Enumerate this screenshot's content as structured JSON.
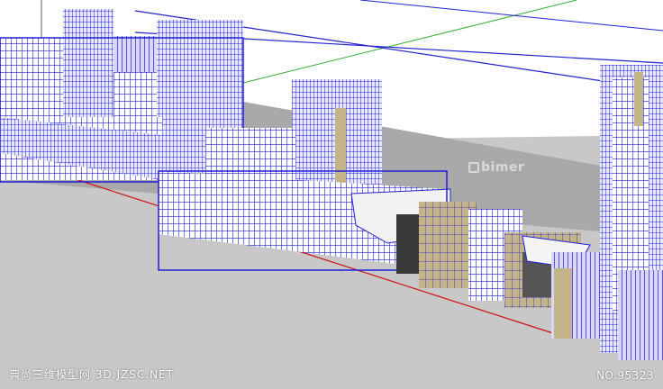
{
  "viewport": {
    "sky_color": "#ffffff",
    "ground_color": "#c8c8c8",
    "slab_color": "#a9a9a9",
    "wire_color": "#1f1fd8",
    "facade_color": "#c4b48a",
    "axis_red": "#d01010",
    "axis_green": "#34b034",
    "axis_blue": "#2222cc"
  },
  "watermarks": {
    "site_name": "典尚三维模型网 3D.JZSC.NET",
    "model_number": "NO.95323",
    "logo_text": "bimer"
  }
}
